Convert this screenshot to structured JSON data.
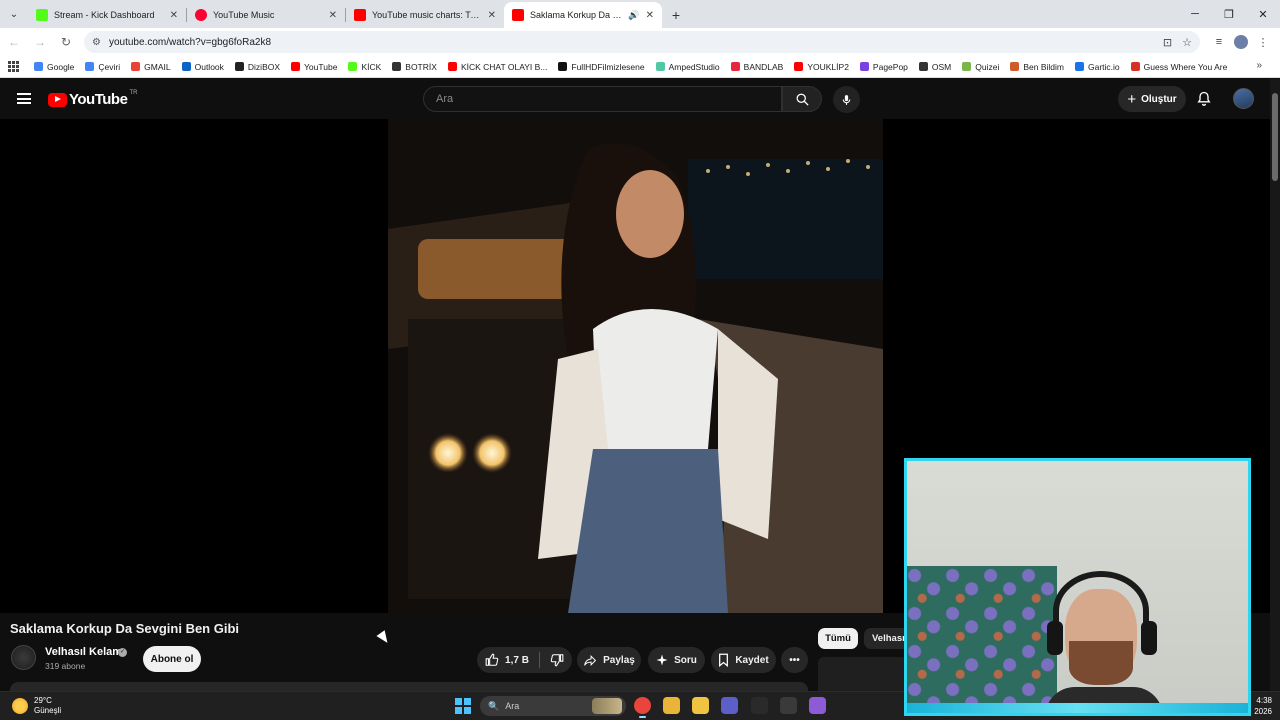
{
  "browser": {
    "tabs": [
      {
        "title": "Stream - Kick Dashboard",
        "favicon_color": "#53fc18",
        "active": false
      },
      {
        "title": "YouTube Music",
        "favicon_color": "#ff0033",
        "active": false
      },
      {
        "title": "YouTube music charts: Turkey T",
        "favicon_color": "#ff0000",
        "active": false
      },
      {
        "title": "Saklama Korkup Da Sevgini",
        "favicon_color": "#ff0000",
        "active": true
      }
    ],
    "url": "youtube.com/watch?v=gbg6foRa2k8",
    "bookmarks": [
      {
        "label": "Google",
        "color": "#4285f4"
      },
      {
        "label": "Çeviri",
        "color": "#4285f4"
      },
      {
        "label": "GMAIL",
        "color": "#ea4335"
      },
      {
        "label": "Outlook",
        "color": "#0a64c8"
      },
      {
        "label": "DiziBOX",
        "color": "#222222"
      },
      {
        "label": "YouTube",
        "color": "#ff0000"
      },
      {
        "label": "KİCK",
        "color": "#53fc18"
      },
      {
        "label": "BOTRİX",
        "color": "#333333"
      },
      {
        "label": "KİCK CHAT OLAYI B...",
        "color": "#ff0000"
      },
      {
        "label": "FullHDFilmizlesene",
        "color": "#111111"
      },
      {
        "label": "AmpedStudio",
        "color": "#4ec9a3"
      },
      {
        "label": "BANDLAB",
        "color": "#e8263c"
      },
      {
        "label": "YOUKLİP2",
        "color": "#ff0000"
      },
      {
        "label": "PagePop",
        "color": "#7b3fe4"
      },
      {
        "label": "OSM",
        "color": "#333333"
      },
      {
        "label": "Quizei",
        "color": "#7ab648"
      },
      {
        "label": "Ben Bildim",
        "color": "#d05a2a"
      },
      {
        "label": "Gartic.io",
        "color": "#1a73e8"
      },
      {
        "label": "Guess Where You Are",
        "color": "#d93025"
      }
    ]
  },
  "youtube": {
    "logo_text": "YouTube",
    "country_code": "TR",
    "search_placeholder": "Ara",
    "create_label": "Oluştur",
    "video": {
      "title": "Saklama Korkup Da Sevgini Ben Gibi",
      "channel": "Velhasıl Kelam",
      "subscribers": "319 abone",
      "subscribe_label": "Abone ol",
      "likes": "1,7 B",
      "share_label": "Paylaş",
      "ask_label": "Soru",
      "save_label": "Kaydet"
    },
    "chips": [
      "Tümü",
      "Velhasıl"
    ]
  },
  "taskbar": {
    "temperature": "29°C",
    "weather": "Güneşli",
    "search_placeholder": "Ara",
    "time": "4:38",
    "date": "2026",
    "apps": [
      {
        "name": "chrome",
        "color": "#e8453c"
      },
      {
        "name": "explorer",
        "color": "#e8b53a"
      },
      {
        "name": "files",
        "color": "#f0c340"
      },
      {
        "name": "teams",
        "color": "#5b5fc7"
      },
      {
        "name": "epic",
        "color": "#2a2a2a"
      },
      {
        "name": "obs",
        "color": "#3a3a3a"
      },
      {
        "name": "app",
        "color": "#8e5bd6"
      }
    ]
  }
}
